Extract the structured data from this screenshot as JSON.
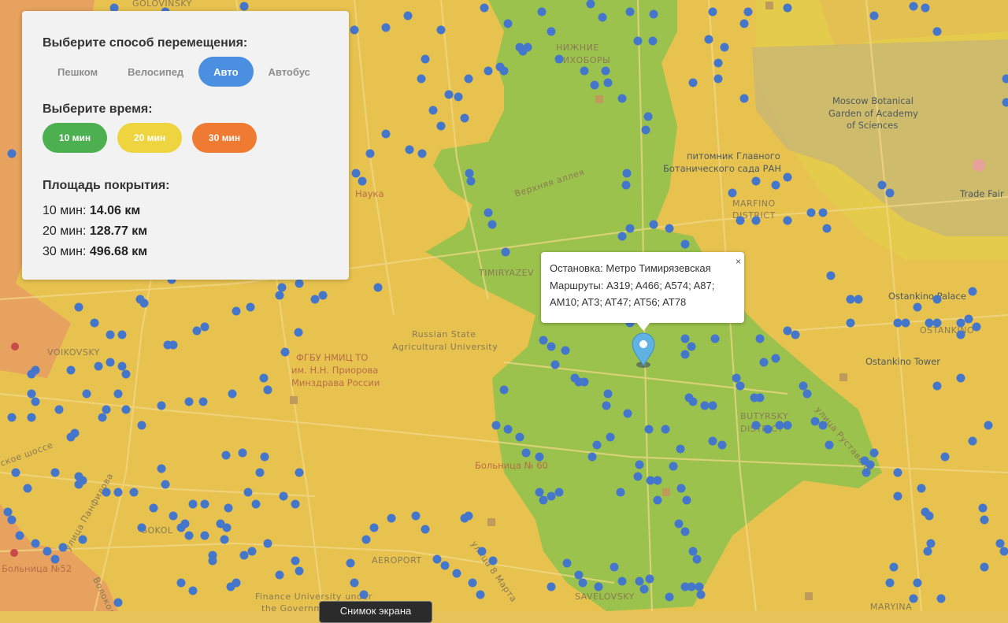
{
  "controls": {
    "mode_title": "Выберите способ перемещения:",
    "modes": [
      "Пешком",
      "Велосипед",
      "Авто",
      "Автобус"
    ],
    "active_mode": "Авто",
    "time_title": "Выберите время:",
    "times": [
      {
        "label": "10 мин",
        "color": "#4caf50"
      },
      {
        "label": "20 мин",
        "color": "#eed53f"
      },
      {
        "label": "30 мин",
        "color": "#ef7a31"
      }
    ],
    "coverage_title": "Площадь покрытия:",
    "coverage": [
      {
        "prefix": "10 мин: ",
        "value": "14.06 км"
      },
      {
        "prefix": "20 мин: ",
        "value": "128.77 км"
      },
      {
        "prefix": "30 мин: ",
        "value": "496.68 км"
      }
    ]
  },
  "popup": {
    "stop": "Остановка: Метро Тимирязевская",
    "routes": "Маршруты: A319; A466; A574; A87; AM10; AT3; AT47; AT56; AT78",
    "close": "×"
  },
  "screenshot_button": "Снимок экрана",
  "map_labels": {
    "golovinsky": "GOLOVINSKY",
    "nizhnie": "НИЖНИЕ",
    "likhobory": "ЛИХОБОРЫ",
    "botanical_1": "Moscow Botanical",
    "botanical_2": "Garden of Academy",
    "botanical_3": "of Sciences",
    "nursery_1": "питомник Главного",
    "nursery_2": "Ботанического сада РАН",
    "trade_fair": "Trade Fair",
    "marfino_1": "MARFINO",
    "marfino_2": "DISTRICT",
    "nauka": "Наука",
    "verkhnyaya": "Верхняя аллея",
    "timiryazev": "TIMIRYAZEV",
    "russian_state_1": "Russian State",
    "russian_state_2": "Agricultural University",
    "voikovsky": "VOIKOVSKY",
    "fgbu_1": "ФГБУ НМИЦ ТО",
    "fgbu_2": "им. Н.Н. Приорова",
    "fgbu_3": "Минздрава России",
    "ostankino_palace": "Ostankino Palace",
    "ostankino": "OSTANKINO",
    "ostankino_tower": "Ostankino Tower",
    "butyrsky_1": "BUTYRSKY",
    "butyrsky_2": "DISTRICT",
    "bolnitsa": "Больница № 60",
    "sokol": "SOKOL",
    "aeroport": "AEROPORT",
    "finance_1": "Finance University under",
    "finance_2": "the Government",
    "savelovsky": "SAVELOVSKY",
    "maryina": "MARYINA",
    "bolnitsa52": "Больница №52",
    "shosse": "ское шоссе",
    "ulitsa_pankino": "улица Панфилова",
    "ulitsa8": "улица 8 Марта",
    "ulitsa_vol": "Волоколамская",
    "street_right": "улица Руставели"
  }
}
